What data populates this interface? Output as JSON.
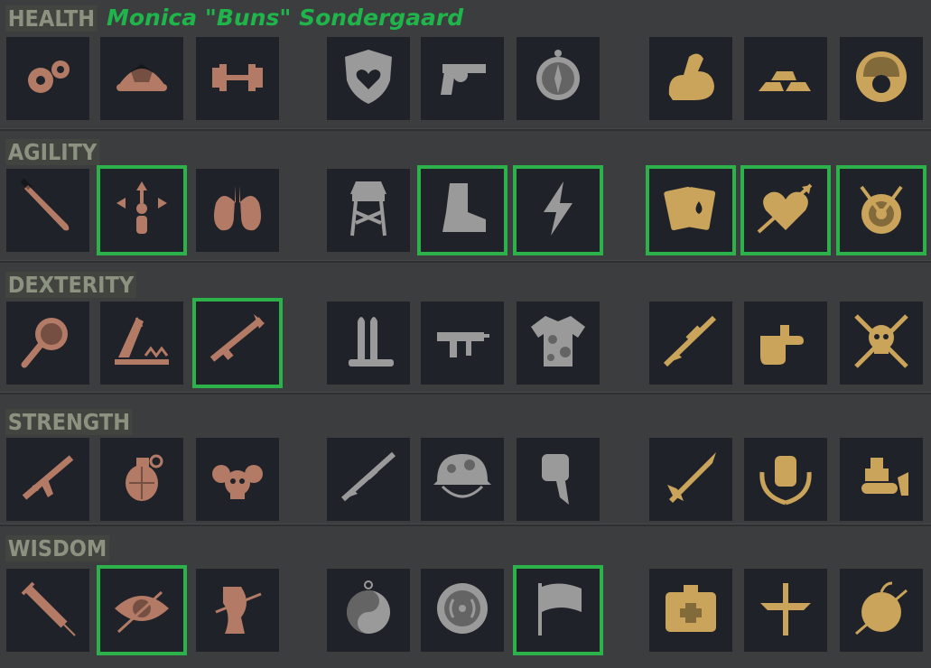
{
  "character": {
    "name": "Monica \"Buns\" Sondergaard"
  },
  "colors": {
    "copper": "#b37a66",
    "steel": "#9a9a9a",
    "gold": "#c9a45a",
    "selected_outline": "#2db14a",
    "name_green": "#1fb54a"
  },
  "categories": [
    {
      "label": "HEALTH",
      "perks": [
        {
          "icon": "gears-icon",
          "tier": "copper",
          "selected": false
        },
        {
          "icon": "turtle-shell-icon",
          "tier": "copper",
          "selected": false
        },
        {
          "icon": "dumbbell-icon",
          "tier": "copper",
          "selected": false
        },
        {
          "icon": "heart-shield-icon",
          "tier": "steel",
          "selected": false
        },
        {
          "icon": "revolver-icon",
          "tier": "steel",
          "selected": false
        },
        {
          "icon": "compass-icon",
          "tier": "steel",
          "selected": false
        },
        {
          "icon": "flexed-arm-icon",
          "tier": "gold",
          "selected": false
        },
        {
          "icon": "gold-bars-icon",
          "tier": "gold",
          "selected": false
        },
        {
          "icon": "soldier-helmet-icon",
          "tier": "gold",
          "selected": false
        }
      ]
    },
    {
      "label": "AGILITY",
      "perks": [
        {
          "icon": "machete-icon",
          "tier": "copper",
          "selected": false
        },
        {
          "icon": "person-arrows-icon",
          "tier": "copper",
          "selected": true
        },
        {
          "icon": "lungs-icon",
          "tier": "copper",
          "selected": false
        },
        {
          "icon": "watchtower-icon",
          "tier": "steel",
          "selected": false
        },
        {
          "icon": "boot-icon",
          "tier": "steel",
          "selected": true
        },
        {
          "icon": "lightning-icon",
          "tier": "steel",
          "selected": true
        },
        {
          "icon": "playing-cards-icon",
          "tier": "gold",
          "selected": true
        },
        {
          "icon": "heart-arrow-icon",
          "tier": "gold",
          "selected": true
        },
        {
          "icon": "target-arrows-icon",
          "tier": "gold",
          "selected": true
        }
      ]
    },
    {
      "label": "DEXTERITY",
      "perks": [
        {
          "icon": "magnifier-icon",
          "tier": "copper",
          "selected": false
        },
        {
          "icon": "bear-trap-icon",
          "tier": "copper",
          "selected": false
        },
        {
          "icon": "rpg-launcher-icon",
          "tier": "copper",
          "selected": true
        },
        {
          "icon": "bullets-icon",
          "tier": "steel",
          "selected": false
        },
        {
          "icon": "smg-icon",
          "tier": "steel",
          "selected": false
        },
        {
          "icon": "camo-shirt-icon",
          "tier": "steel",
          "selected": false
        },
        {
          "icon": "sniper-rifle-icon",
          "tier": "gold",
          "selected": false
        },
        {
          "icon": "finger-gun-icon",
          "tier": "gold",
          "selected": false
        },
        {
          "icon": "skull-crossed-rifles-icon",
          "tier": "gold",
          "selected": false
        }
      ]
    },
    {
      "label": "STRENGTH",
      "perks": [
        {
          "icon": "assault-rifle-icon",
          "tier": "copper",
          "selected": false
        },
        {
          "icon": "grenade-icon",
          "tier": "copper",
          "selected": false
        },
        {
          "icon": "skull-pile-icon",
          "tier": "copper",
          "selected": false
        },
        {
          "icon": "shotgun-icon",
          "tier": "steel",
          "selected": false
        },
        {
          "icon": "camo-helmet-icon",
          "tier": "steel",
          "selected": false
        },
        {
          "icon": "fist-knife-icon",
          "tier": "steel",
          "selected": false
        },
        {
          "icon": "missile-icon",
          "tier": "gold",
          "selected": false
        },
        {
          "icon": "laurel-fist-icon",
          "tier": "gold",
          "selected": false
        },
        {
          "icon": "bulldozer-icon",
          "tier": "gold",
          "selected": false
        }
      ]
    },
    {
      "label": "WISDOM",
      "perks": [
        {
          "icon": "syringe-icon",
          "tier": "copper",
          "selected": false
        },
        {
          "icon": "eye-arrow-icon",
          "tier": "copper",
          "selected": true
        },
        {
          "icon": "arrow-knee-icon",
          "tier": "copper",
          "selected": false
        },
        {
          "icon": "yin-yang-icon",
          "tier": "steel",
          "selected": false
        },
        {
          "icon": "signal-icon",
          "tier": "steel",
          "selected": false
        },
        {
          "icon": "flag-icon",
          "tier": "steel",
          "selected": true
        },
        {
          "icon": "medkit-icon",
          "tier": "gold",
          "selected": false
        },
        {
          "icon": "winged-sword-icon",
          "tier": "gold",
          "selected": false
        },
        {
          "icon": "apple-arrow-icon",
          "tier": "gold",
          "selected": false
        }
      ]
    }
  ]
}
